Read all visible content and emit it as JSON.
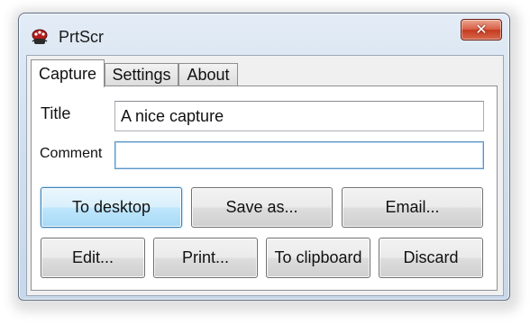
{
  "window": {
    "title": "PrtScr",
    "close_glyph": "✕",
    "app_icon": "bug-icon",
    "close_color": "#c43a1e"
  },
  "tabs": [
    {
      "label": "Capture",
      "active": true
    },
    {
      "label": "Settings",
      "active": false
    },
    {
      "label": "About",
      "active": false
    }
  ],
  "form": {
    "title_label": "Title",
    "title_value": "A nice capture",
    "comment_label": "Comment",
    "comment_value": ""
  },
  "buttons": {
    "to_desktop": "To desktop",
    "save_as": "Save as...",
    "email": "Email...",
    "edit": "Edit...",
    "print": "Print...",
    "to_clipboard": "To clipboard",
    "discard": "Discard"
  }
}
